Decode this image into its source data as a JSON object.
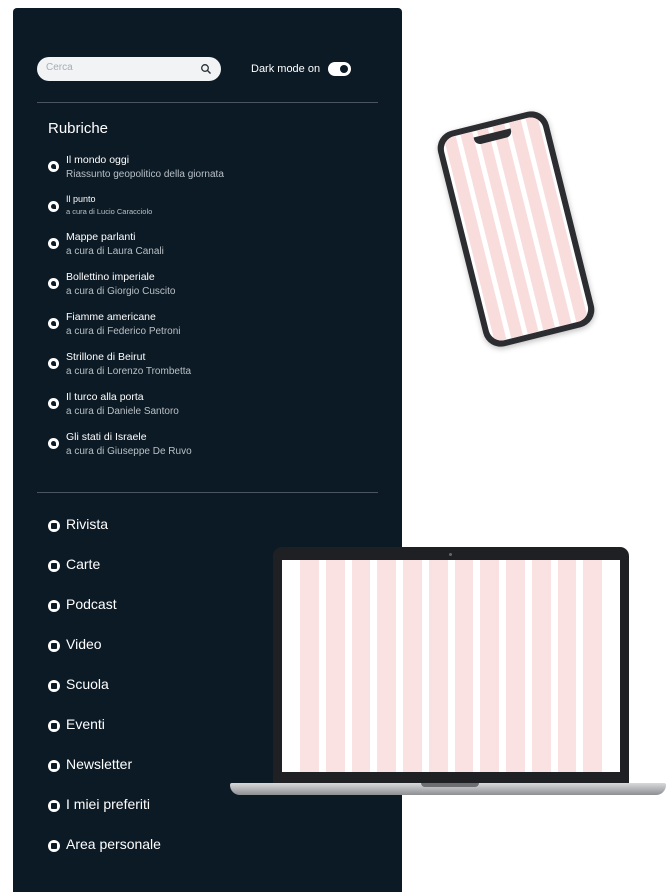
{
  "search": {
    "placeholder": "Cerca",
    "icon": "search-icon"
  },
  "dark_mode": {
    "label": "Dark mode on",
    "enabled": true
  },
  "rubriche": {
    "title": "Rubriche",
    "items": [
      {
        "title": "Il mondo oggi",
        "subtitle": "Riassunto geopolitico della giornata"
      },
      {
        "title": "Il punto",
        "subtitle": "a cura di Lucio Caracciolo"
      },
      {
        "title": "Mappe parlanti",
        "subtitle": "a cura di Laura Canali"
      },
      {
        "title": "Bollettino imperiale",
        "subtitle": "a cura di Giorgio Cuscito"
      },
      {
        "title": "Fiamme americane",
        "subtitle": "a cura di Federico Petroni"
      },
      {
        "title": "Strillone di Beirut",
        "subtitle": "a cura di Lorenzo Trombetta"
      },
      {
        "title": "Il turco alla porta",
        "subtitle": "a cura di Daniele Santoro"
      },
      {
        "title": "Gli stati di Israele",
        "subtitle": "a cura di Giuseppe De Ruvo"
      }
    ]
  },
  "menu": [
    {
      "label": "Rivista",
      "icon": "magazine-icon"
    },
    {
      "label": "Carte",
      "icon": "map-pin-icon"
    },
    {
      "label": "Podcast",
      "icon": "microphone-icon"
    },
    {
      "label": "Video",
      "icon": "play-icon"
    },
    {
      "label": "Scuola",
      "icon": "graduation-cap-icon"
    },
    {
      "label": "Eventi",
      "icon": "calendar-icon"
    },
    {
      "label": "Newsletter",
      "icon": "mail-icon"
    },
    {
      "label": "I miei preferiti",
      "icon": "bookmark-icon"
    },
    {
      "label": "Area personale",
      "icon": "user-icon"
    }
  ],
  "colors": {
    "panel": "#0c1a25",
    "grid_column": "#fbe2e2"
  }
}
